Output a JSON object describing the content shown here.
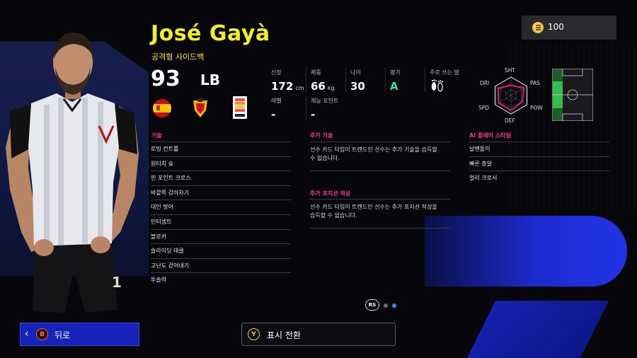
{
  "header": {
    "player_name": "José Gayà",
    "position_full": "공격형 사이드백",
    "rating": "93",
    "position": "LB"
  },
  "icons": {
    "flag": "spain-flag",
    "club": "valencia-club-crest",
    "league": "la-liga-logo",
    "foot": "footprints-icon"
  },
  "stats": {
    "height": {
      "label": "신장",
      "value": "172",
      "unit": "cm"
    },
    "weight": {
      "label": "체중",
      "value": "66",
      "unit": "kg"
    },
    "age": {
      "label": "나이",
      "value": "30"
    },
    "grade": {
      "label": "평가",
      "value": "A"
    },
    "foot": {
      "label": "주로 쓰는 발"
    },
    "level": {
      "label": "레벨",
      "value": "-"
    },
    "talent_points": {
      "label": "재능 포인트",
      "value": "-"
    }
  },
  "radar": {
    "labels": {
      "top": "SHT",
      "top_right": "PAS",
      "bottom_right": "POW",
      "bottom": "DEF",
      "bottom_left": "SPD",
      "top_left": "DRI"
    },
    "values": {
      "SHT": 0.55,
      "PAS": 0.82,
      "POW": 0.7,
      "DEF": 0.8,
      "SPD": 0.78,
      "DRI": 0.8
    },
    "colors": {
      "fill": "#e0177a",
      "frame": "#ffffff"
    }
  },
  "pitch": {
    "highlight_zone": "left-back",
    "highlight_color": "#2fbf4a"
  },
  "coins": {
    "value": "100"
  },
  "skills": {
    "title": "기술",
    "items": [
      "로빙 컨트롤",
      "원터치 슛",
      "핀 포인트 크로스",
      "바깥쪽 감아차기",
      "대인 방어",
      "인터셉트",
      "블로커",
      "슬라이딩 태클",
      "고난도 걷어내기",
      "투슬럭"
    ]
  },
  "extra_skills": {
    "title": "추가 기술",
    "desc": "선수 카드 타입이 트렌드인 선수는 추가 기술을 습득할 수 없습니다."
  },
  "extra_positions": {
    "title": "추가 포지션 적성",
    "desc": "선수 카드 타입이 트렌드인 선수는 추가 포지션 적성을 습득할 수 없습니다."
  },
  "ai_styles": {
    "title": "AI 플레이 스타일",
    "items": [
      "날쌘돌이",
      "빠른 총알",
      "얼리 크로서"
    ]
  },
  "paging": {
    "button": "RS",
    "active_page": 2,
    "page_count": 2
  },
  "footer": {
    "back": {
      "badge": "B",
      "label": "뒤로"
    },
    "toggle": {
      "badge": "Y",
      "label": "표시 전환"
    }
  }
}
